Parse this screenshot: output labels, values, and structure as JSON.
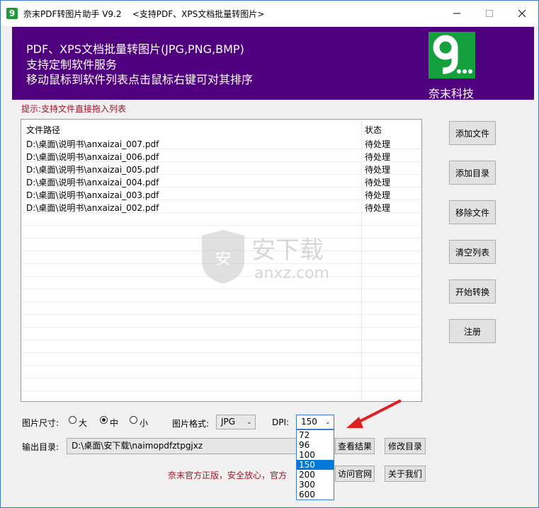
{
  "window": {
    "title": "奈末PDF转图片助手 V9.2    <支持PDF、XPS文档批量转图片>",
    "app_icon": "9"
  },
  "banner": {
    "line1": "PDF、XPS文档批量转图片(JPG,PNG,BMP)",
    "line2": "支持定制软件服务",
    "line3": "移动鼠标到软件列表点击鼠标右键可对其排序",
    "company": "奈末科技",
    "bg_color": "#50007e"
  },
  "hint": "提示:支持文件直接拖入列表",
  "list": {
    "headers": [
      "文件路径",
      "状态"
    ],
    "rows": [
      {
        "path": "D:\\桌面\\说明书\\anxaizai_007.pdf",
        "status": "待处理"
      },
      {
        "path": "D:\\桌面\\说明书\\anxaizai_006.pdf",
        "status": "待处理"
      },
      {
        "path": "D:\\桌面\\说明书\\anxaizai_005.pdf",
        "status": "待处理"
      },
      {
        "path": "D:\\桌面\\说明书\\anxaizai_004.pdf",
        "status": "待处理"
      },
      {
        "path": "D:\\桌面\\说明书\\anxaizai_003.pdf",
        "status": "待处理"
      },
      {
        "path": "D:\\桌面\\说明书\\anxaizai_002.pdf",
        "status": "待处理"
      }
    ]
  },
  "watermark": {
    "cn": "安下载",
    "en": "anxz.com"
  },
  "buttons": {
    "add_file": "添加文件",
    "add_dir": "添加目录",
    "remove_file": "移除文件",
    "clear_list": "清空列表",
    "start": "开始转换",
    "register": "注册",
    "view_result": "查看结果",
    "modify_dir": "修改目录",
    "visit_site": "访问官网",
    "about": "关于我们"
  },
  "controls": {
    "size_label": "图片尺寸:",
    "size_options": [
      "大",
      "中",
      "小"
    ],
    "size_selected": "中",
    "format_label": "图片格式:",
    "format_value": "JPG",
    "dpi_label": "DPI:",
    "dpi_value": "150",
    "dpi_options": [
      "72",
      "96",
      "100",
      "150",
      "200",
      "300",
      "600"
    ],
    "output_label": "输出目录:",
    "output_value": "D:\\桌面\\安下载\\naimopdfztpgjxz"
  },
  "footer_note": "奈末官方正版，安全放心，官方"
}
